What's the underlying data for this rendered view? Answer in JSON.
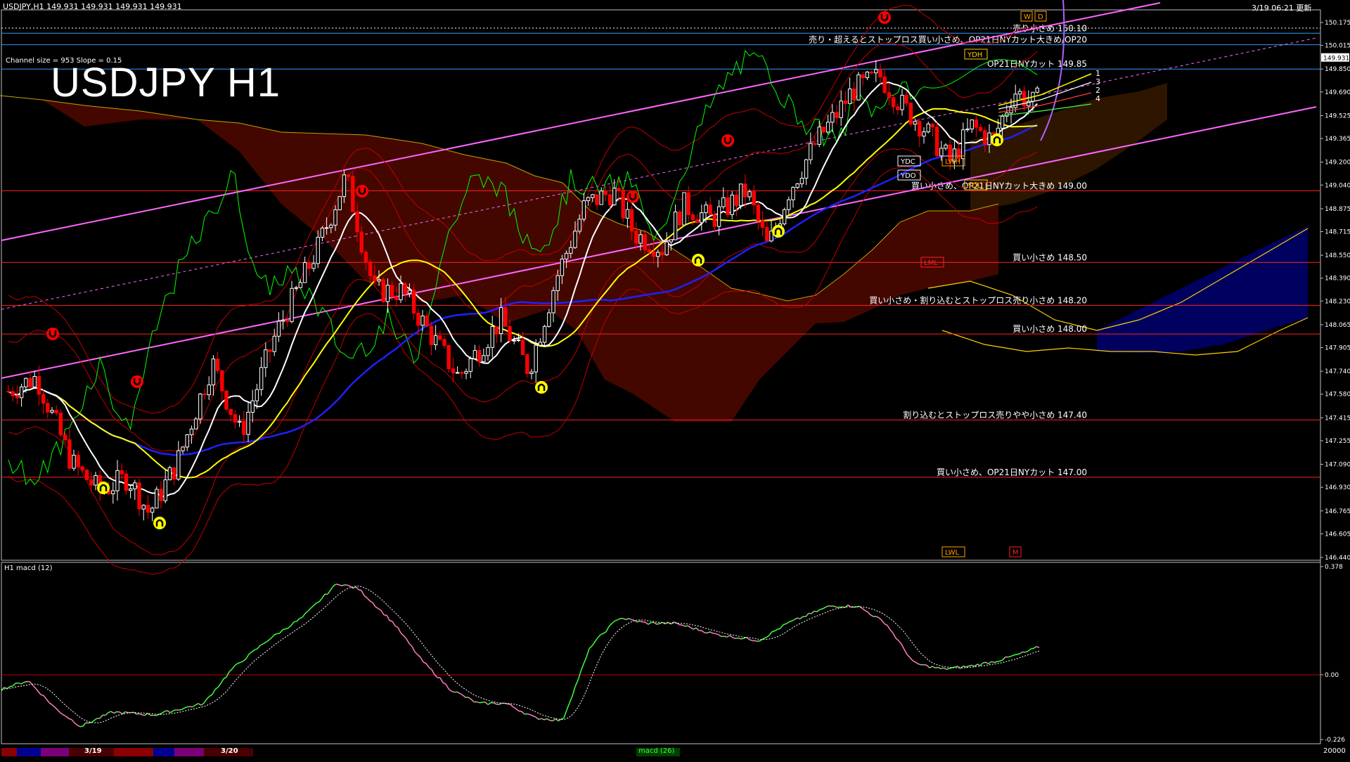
{
  "header": {
    "symbol_info": "USDJPY,H1  149.931 149.931 149.931 149.931",
    "updated": "3/19 06:21 更新",
    "chart_title": "USDJPY H1",
    "channel_info": "Channel size = 953 Slope = 0.15",
    "macd_title": "H1  macd (12)"
  },
  "colors": {
    "background": "#000000",
    "bull_candle": "#ffffff",
    "bear_candle": "#ff0000",
    "level_line": "#ff2020",
    "blue_line": "#4080ff",
    "channel": "#ff66ff",
    "ma_fast": "#ffffff",
    "ma_mid": "#ffff00",
    "ma_slow": "#2020ff",
    "chikou": "#00ff00",
    "macd_up": "#40ff40",
    "macd_down": "#ff80c0",
    "cloud_red": "#ff4040",
    "cloud_blue": "#4060ff"
  },
  "chart_data": {
    "type": "candlestick",
    "y_range": [
      146.44,
      150.175
    ],
    "y_ticks": [
      "150.175",
      "150.015",
      "149.850",
      "149.690",
      "149.525",
      "149.365",
      "149.200",
      "149.040",
      "148.875",
      "148.715",
      "148.550",
      "148.390",
      "148.230",
      "148.065",
      "147.905",
      "147.740",
      "147.580",
      "147.415",
      "147.255",
      "147.090",
      "146.930",
      "146.765",
      "146.605",
      "146.440"
    ],
    "current_price": "149.931",
    "levels": [
      {
        "price": 150.1,
        "label": "売り小さめ 150.10",
        "color": "#3399ff"
      },
      {
        "price": 150.02,
        "label": "売り・超えるとストップロス買い小さめ、OP21日NYカット大きめ/OP20",
        "color": "#3399ff"
      },
      {
        "price": 149.85,
        "label": "OP21日NYカット 149.85",
        "color": "#3399ff"
      },
      {
        "price": 149.0,
        "label": "買い小さめ、OP21日NYカット大きめ 149.00",
        "color": "#ff2020"
      },
      {
        "price": 148.5,
        "label": "買い小さめ 148.50",
        "color": "#ff2020"
      },
      {
        "price": 148.2,
        "label": "買い小さめ・割り込むとストップロス売り小さめ 148.20",
        "color": "#ff2020"
      },
      {
        "price": 148.0,
        "label": "買い小さめ 148.00",
        "color": "#ff2020"
      },
      {
        "price": 147.4,
        "label": "割り込むとストップロス売りやや小さめ 147.40",
        "color": "#ff2020"
      },
      {
        "price": 147.0,
        "label": "買い小さめ、OP21日NYカット 147.00",
        "color": "#ff2020"
      }
    ],
    "box_labels": [
      "YDH",
      "YDC",
      "YDO",
      "YDL",
      "LWH",
      "LML",
      "LWL",
      "W",
      "D",
      "M"
    ],
    "line_numbers": [
      "1",
      "3",
      "2",
      "4"
    ],
    "macd": {
      "y_ticks": [
        "0.378",
        "0.00",
        "-0.226"
      ],
      "range": [
        -0.226,
        0.378
      ]
    },
    "date_labels": [
      "3/19",
      "3/20"
    ],
    "bottom_label": "macd (26)",
    "bottom_right": "20000"
  }
}
